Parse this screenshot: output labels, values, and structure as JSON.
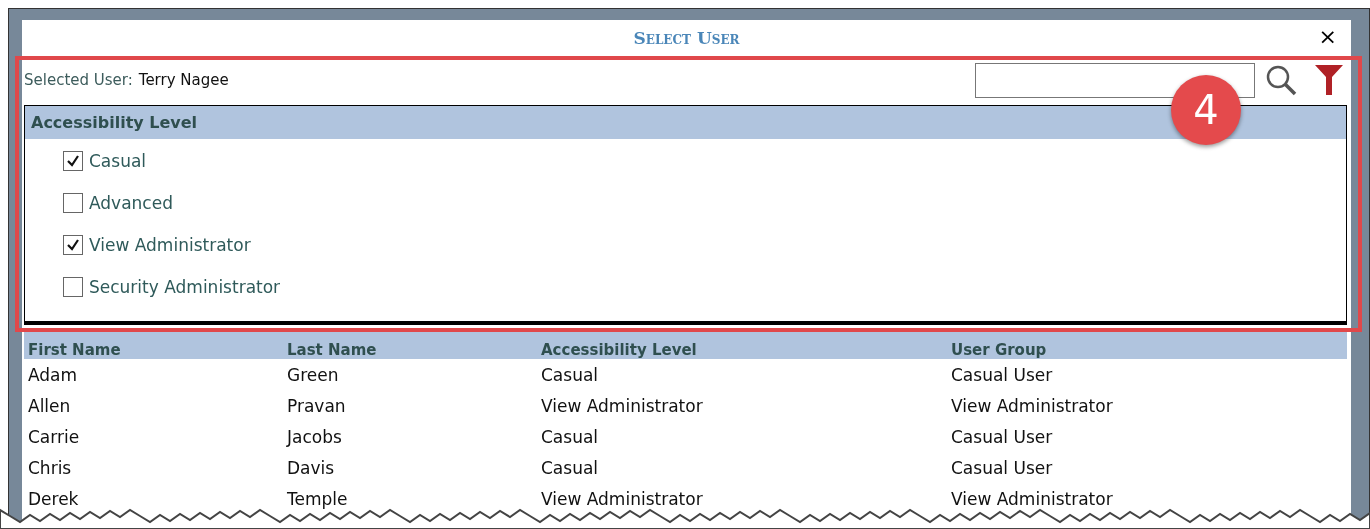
{
  "dialog": {
    "title": "Select User",
    "close": "×"
  },
  "selected_user": {
    "label": "Selected User:",
    "value": "Terry Nagee"
  },
  "filter_panel": {
    "heading": "Accessibility Level",
    "options": [
      {
        "label": "Casual",
        "checked": true
      },
      {
        "label": "Advanced",
        "checked": false
      },
      {
        "label": "View Administrator",
        "checked": true
      },
      {
        "label": "Security Administrator",
        "checked": false
      }
    ]
  },
  "table": {
    "columns": [
      "First Name",
      "Last Name",
      "Accessibility Level",
      "User Group"
    ],
    "rows": [
      [
        "Adam",
        "Green",
        "Casual",
        "Casual User"
      ],
      [
        "Allen",
        "Pravan",
        "View Administrator",
        "View Administrator"
      ],
      [
        "Carrie",
        "Jacobs",
        "Casual",
        "Casual User"
      ],
      [
        "Chris",
        "Davis",
        "Casual",
        "Casual User"
      ],
      [
        "Derek",
        "Temple",
        "View Administrator",
        "View Administrator"
      ]
    ]
  },
  "callout": {
    "number": "4"
  }
}
